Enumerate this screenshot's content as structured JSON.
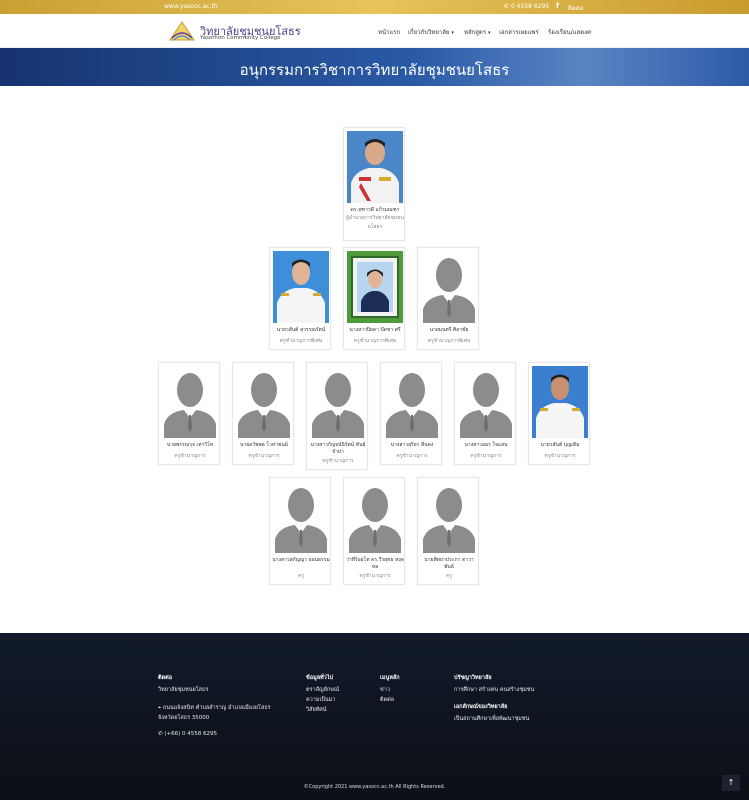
{
  "topbar": {
    "domain": "www.yasocc.ac.th",
    "phone": "0 4558 6295",
    "facebook_glyph": "f",
    "contact": "ติดต่อ"
  },
  "header": {
    "logo_th": "วิทยาลัยชุมชนยโสธร",
    "logo_en": "Yasothon Community College",
    "nav": [
      {
        "label": "หน้าแรก"
      },
      {
        "label": "เกี่ยวกับวิทยาลัย"
      },
      {
        "label": "หลักสูตร"
      },
      {
        "label": "เอกสารเผยแพร่"
      },
      {
        "label": "ร้องเรียน/แสดงความคิดเห็น"
      }
    ]
  },
  "banner": {
    "title": "อนุกรรมการวิชาการวิทยาลัยชุมชนยโสธร"
  },
  "people": [
    {
      "name": "ดร.จุฑาวดี แก้วมณฑา",
      "role": "ผู้อำนวยการวิทยาลัยชุมชนยโสธร",
      "photo": "director"
    },
    {
      "name": "นายวสันต์ สุวรรณรัตน์",
      "role": "ครูชำนาญการพิเศษ",
      "photo": "man-white"
    },
    {
      "name": "นางสาวปิยดา ปัดชา ศรี",
      "role": "ครูชำนาญการพิเศษ",
      "photo": "woman-frame"
    },
    {
      "name": "นายมนตรี ศิลาชัย",
      "role": "ครูชำนาญการพิเศษ",
      "photo": "placeholder"
    },
    {
      "name": "นายพรรณรุจ เทาวิโท",
      "role": "ครูชำนาญการ",
      "photo": "placeholder"
    },
    {
      "name": "นายธวัชพล โวหาชนม์",
      "role": "ครูชำนาญการ",
      "photo": "placeholder"
    },
    {
      "name": "นางสาวกัญจน์นิรัตน์ พันธุ์จำปา",
      "role": "ครูชำนาญการ",
      "photo": "placeholder"
    },
    {
      "name": "นางสาวสุริยา สิ่นคง",
      "role": "ครูชำนาญการ",
      "photo": "placeholder"
    },
    {
      "name": "นางสาวอมร ใจแสน",
      "role": "ครูชำนาญการ",
      "photo": "placeholder"
    },
    {
      "name": "นายวสันต์ บุญเติม",
      "role": "ครูชำนาญการ",
      "photo": "man-blue"
    },
    {
      "name": "นางสาวสุกัญญา ออนธรรม",
      "role": "ครู",
      "photo": "placeholder"
    },
    {
      "name": "ว่าที่ร้อยโท ดร.วีรยุทธ หงุดหล",
      "role": "ครูชำนาญการ",
      "photo": "placeholder"
    },
    {
      "name": "นายพิทยาประภา ดาวาพันธ์",
      "role": "ครู",
      "photo": "placeholder"
    }
  ],
  "footer": {
    "contact_heading": "ติดต่อ",
    "college_name": "วิทยาลัยชุมชนยโสธร",
    "address_line1": "ถนนแจ้งสนิท ตำบลสำราญ อำเภอเมืองยโสธร",
    "address_line2": "จังหวัดยโสธร 35000",
    "phone": "(+66) 0 4558 6295",
    "info_heading": "ข้อมูลทั่วไป",
    "info_links": [
      "ตราสัญลักษณ์",
      "ความเป็นมา",
      "วิสัยทัศน์"
    ],
    "menu_heading": "เมนูหลัก",
    "menu_links": [
      "ข่าว",
      "ติดต่อ"
    ],
    "philosophy_heading": "ปรัชญาวิทยาลัย",
    "philosophy": "การศึกษา สร้างคน คนสร้างชุมชน",
    "identity_heading": "เอกลักษณ์ของวิทยาลัย",
    "identity": "เป็นสถานศึกษาเพื่อพัฒนาชุมชน",
    "copyright": "©Copyright 2021 www.yasocc.ac.th All Rights Reserved.",
    "backtop_glyph": "↑"
  }
}
